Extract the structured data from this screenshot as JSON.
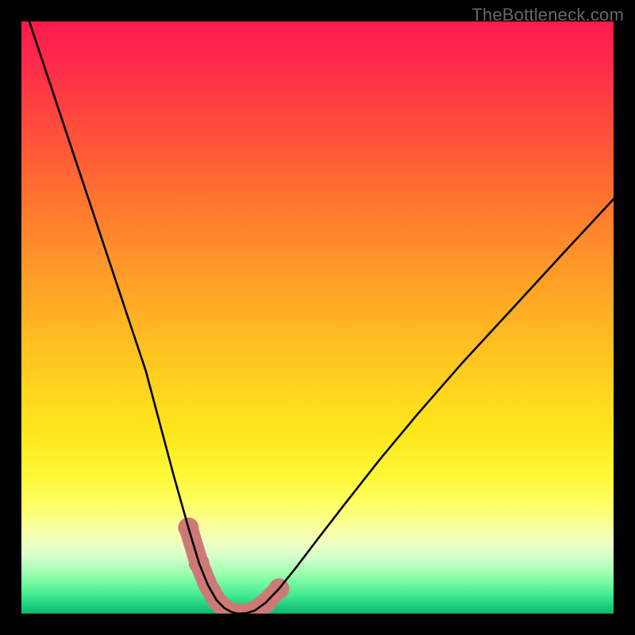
{
  "watermark": "TheBottleneck.com",
  "chart_data": {
    "type": "line",
    "title": "",
    "xlabel": "",
    "ylabel": "",
    "xlim": [
      0,
      100
    ],
    "ylim": [
      0,
      100
    ],
    "background_gradient_stops": [
      {
        "pos": 0,
        "color": "#ff1a4d"
      },
      {
        "pos": 50,
        "color": "#ffd41e"
      },
      {
        "pos": 85,
        "color": "#feff6a"
      },
      {
        "pos": 100,
        "color": "#10b870"
      }
    ],
    "series": [
      {
        "name": "left-curve",
        "x": [
          0,
          3,
          6,
          9,
          12,
          15,
          18,
          21,
          23.4,
          25.8,
          28.2,
          30,
          31.5,
          33,
          34.3,
          35.5,
          36.3,
          37.0
        ],
        "y": [
          104,
          95,
          86,
          77,
          68,
          59,
          50,
          41,
          32,
          23,
          14.5,
          8.5,
          4.8,
          2.2,
          0.9,
          0.25,
          0.05,
          0.0
        ]
      },
      {
        "name": "right-curve",
        "x": [
          37.0,
          38.0,
          39.4,
          41.2,
          43.5,
          46.4,
          50.2,
          55.0,
          60.5,
          67.0,
          74.5,
          83.0,
          92.0,
          100.0
        ],
        "y": [
          0.0,
          0.08,
          0.5,
          1.8,
          4.2,
          7.8,
          12.8,
          19.0,
          26.0,
          33.8,
          42.4,
          51.6,
          61.4,
          70.0
        ]
      }
    ],
    "bead_band": {
      "name": "highlight-band",
      "color": "#cd7a76",
      "x": [
        28.2,
        30.0,
        31.5,
        33.0,
        34.3,
        35.5,
        37.0,
        38.0,
        39.4,
        41.2,
        43.5
      ],
      "y": [
        14.5,
        8.5,
        4.8,
        2.2,
        0.9,
        0.25,
        0.0,
        0.08,
        0.5,
        1.8,
        4.2
      ],
      "dot_indices_left": [
        0,
        1
      ],
      "dot_indices_right": [
        8,
        9,
        10
      ]
    }
  }
}
